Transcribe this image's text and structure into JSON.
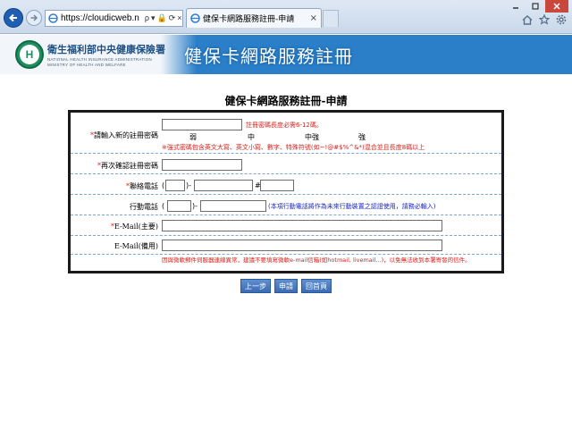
{
  "browser": {
    "url": "https://cloudicweb.n",
    "tab_title": "健保卡網路服務註冊-申請",
    "tab_close": "×",
    "address_tools": [
      "ρ",
      "▾",
      "🔒",
      "⟳",
      "×"
    ]
  },
  "header": {
    "agency_name": "衛生福利部中央健康保險署",
    "agency_name_en_1": "NATIONAL HEALTH INSURANCE ADMINISTRATION",
    "agency_name_en_2": "MINISTRY OF HEALTH AND WELFARE",
    "service_title": "健保卡網路服務註冊"
  },
  "form": {
    "title": "健保卡網路服務註冊-申請",
    "password_label": "請輸入新的註冊密碼",
    "password_hint": "註冊密碼長度必需6-12碼。",
    "strength": [
      "弱",
      "中",
      "中強",
      "強"
    ],
    "password_rule": "※強式密碼包含英文大寫、英文小寫、數字、特殊符號(如~!@#$%^&*)混合並且長度8碼以上",
    "confirm_label": "再次確認註冊密碼",
    "phone_label": "聯絡電話",
    "phone_open_paren": "(",
    "phone_close_dash": ")-",
    "phone_ext": "#",
    "mobile_label": "行動電話",
    "mobile_open_paren": "(",
    "mobile_close_dash": ")-",
    "mobile_hint": "(本項行動電話將作為未來行動裝置之認證使用，請務必輸入)",
    "email_main_label": "E-Mail(主要)",
    "email_backup_label": "E-Mail(備用)",
    "email_notice": "因與微軟郵件伺服器連線異常，建議不要填寫微軟e-mail信箱(如hotmail, livemail...)，以免無法收到本署寄發的信件。",
    "required_mark": "*"
  },
  "buttons": {
    "prev": "上一步",
    "apply": "申請",
    "home": "回首頁"
  },
  "colors": {
    "header_blue": "#2b7fc8",
    "required_red": "#e0201a",
    "hint_blue": "#1b26b8",
    "button_blue": "#3a6bb4"
  }
}
